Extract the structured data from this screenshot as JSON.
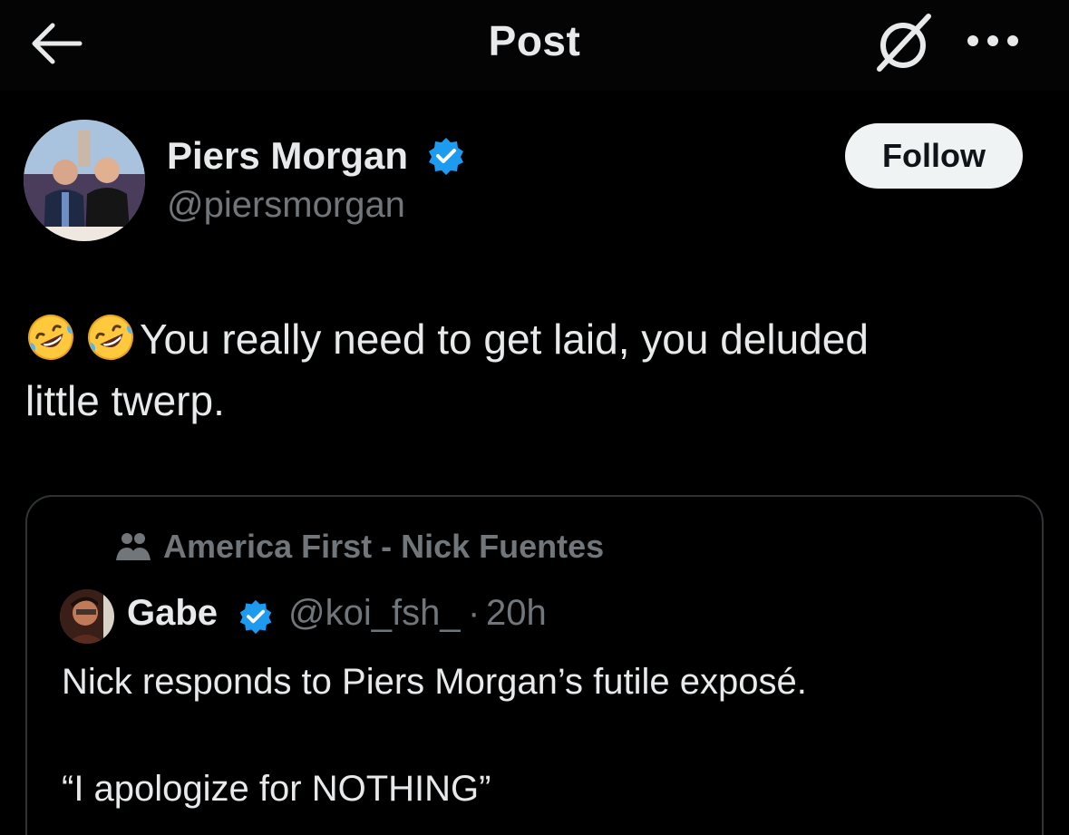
{
  "header": {
    "title": "Post",
    "back_icon": "arrow-left-icon",
    "grok_icon": "grok-slash-icon",
    "more_icon": "ellipsis-icon"
  },
  "author": {
    "name": "Piers Morgan",
    "handle": "@piersmorgan",
    "verified": true,
    "follow_label": "Follow"
  },
  "post": {
    "emojis": [
      "rolling-on-floor-laughing-emoji",
      "rolling-on-floor-laughing-emoji"
    ],
    "text_line1": "You really need to get laid, you deluded",
    "text_line2": "little twerp."
  },
  "quote": {
    "community": "America First - Nick Fuentes",
    "name": "Gabe",
    "verified": true,
    "handle": "@koi_fsh_",
    "separator": "·",
    "time": "20h",
    "text_line1": "Nick responds to Piers Morgan’s futile exposé.",
    "text_line2": "“I apologize for NOTHING”"
  },
  "colors": {
    "background": "#000000",
    "text_primary": "#e7e9ea",
    "text_secondary": "#71767b",
    "verified_blue": "#1d9bf0",
    "follow_bg": "#eff3f4",
    "border": "#2f3336"
  }
}
